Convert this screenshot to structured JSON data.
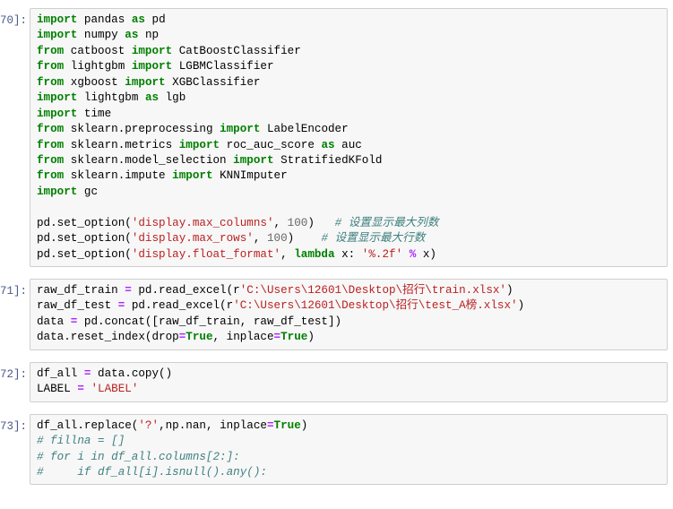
{
  "app": {
    "name": "jupyter-notebook",
    "background": "#ffffff"
  },
  "theme": {
    "cell_background": "#f7f7f7",
    "cell_border": "#cfcfcf",
    "prompt_color": "#4a5a8a",
    "keyword_color": "#008000",
    "string_color": "#BA2121",
    "comment_color": "#408080",
    "operator_color": "#AA22FF",
    "number_color": "#666666",
    "text_color": "#000000"
  },
  "cells": [
    {
      "prompt": "70]:",
      "lines": [
        [
          {
            "t": "import",
            "c": "k"
          },
          {
            "t": " pandas ",
            "c": "nn"
          },
          {
            "t": "as",
            "c": "k"
          },
          {
            "t": " pd",
            "c": "nn"
          }
        ],
        [
          {
            "t": "import",
            "c": "k"
          },
          {
            "t": " numpy ",
            "c": "nn"
          },
          {
            "t": "as",
            "c": "k"
          },
          {
            "t": " np",
            "c": "nn"
          }
        ],
        [
          {
            "t": "from",
            "c": "k"
          },
          {
            "t": " catboost ",
            "c": "nn"
          },
          {
            "t": "import",
            "c": "k"
          },
          {
            "t": " CatBoostClassifier",
            "c": "nn"
          }
        ],
        [
          {
            "t": "from",
            "c": "k"
          },
          {
            "t": " lightgbm ",
            "c": "nn"
          },
          {
            "t": "import",
            "c": "k"
          },
          {
            "t": " LGBMClassifier",
            "c": "nn"
          }
        ],
        [
          {
            "t": "from",
            "c": "k"
          },
          {
            "t": " xgboost ",
            "c": "nn"
          },
          {
            "t": "import",
            "c": "k"
          },
          {
            "t": " XGBClassifier",
            "c": "nn"
          }
        ],
        [
          {
            "t": "import",
            "c": "k"
          },
          {
            "t": " lightgbm ",
            "c": "nn"
          },
          {
            "t": "as",
            "c": "k"
          },
          {
            "t": " lgb",
            "c": "nn"
          }
        ],
        [
          {
            "t": "import",
            "c": "k"
          },
          {
            "t": " time",
            "c": "nn"
          }
        ],
        [
          {
            "t": "from",
            "c": "k"
          },
          {
            "t": " sklearn.preprocessing ",
            "c": "nn"
          },
          {
            "t": "import",
            "c": "k"
          },
          {
            "t": " LabelEncoder",
            "c": "nn"
          }
        ],
        [
          {
            "t": "from",
            "c": "k"
          },
          {
            "t": " sklearn.metrics ",
            "c": "nn"
          },
          {
            "t": "import",
            "c": "k"
          },
          {
            "t": " roc_auc_score ",
            "c": "nn"
          },
          {
            "t": "as",
            "c": "k"
          },
          {
            "t": " auc",
            "c": "nn"
          }
        ],
        [
          {
            "t": "from",
            "c": "k"
          },
          {
            "t": " sklearn.model_selection ",
            "c": "nn"
          },
          {
            "t": "import",
            "c": "k"
          },
          {
            "t": " StratifiedKFold",
            "c": "nn"
          }
        ],
        [
          {
            "t": "from",
            "c": "k"
          },
          {
            "t": " sklearn.impute ",
            "c": "nn"
          },
          {
            "t": "import",
            "c": "k"
          },
          {
            "t": " KNNImputer",
            "c": "nn"
          }
        ],
        [
          {
            "t": "import",
            "c": "k"
          },
          {
            "t": " gc",
            "c": "nn"
          }
        ],
        [
          {
            "t": "",
            "c": "nn"
          }
        ],
        [
          {
            "t": "pd.set_option(",
            "c": "nn"
          },
          {
            "t": "'display.max_columns'",
            "c": "s"
          },
          {
            "t": ", ",
            "c": "nn"
          },
          {
            "t": "100",
            "c": "n"
          },
          {
            "t": ")   ",
            "c": "nn"
          },
          {
            "t": "# 设置显示最大列数",
            "c": "c"
          }
        ],
        [
          {
            "t": "pd.set_option(",
            "c": "nn"
          },
          {
            "t": "'display.max_rows'",
            "c": "s"
          },
          {
            "t": ", ",
            "c": "nn"
          },
          {
            "t": "100",
            "c": "n"
          },
          {
            "t": ")    ",
            "c": "nn"
          },
          {
            "t": "# 设置显示最大行数",
            "c": "c"
          }
        ],
        [
          {
            "t": "pd.set_option(",
            "c": "nn"
          },
          {
            "t": "'display.float_format'",
            "c": "s"
          },
          {
            "t": ", ",
            "c": "nn"
          },
          {
            "t": "lambda",
            "c": "k"
          },
          {
            "t": " x: ",
            "c": "nn"
          },
          {
            "t": "'%.2f'",
            "c": "s"
          },
          {
            "t": " ",
            "c": "nn"
          },
          {
            "t": "%",
            "c": "o"
          },
          {
            "t": " x)",
            "c": "nn"
          }
        ]
      ]
    },
    {
      "prompt": "71]:",
      "lines": [
        [
          {
            "t": "raw_df_train ",
            "c": "nn"
          },
          {
            "t": "=",
            "c": "o"
          },
          {
            "t": " pd.read_excel(r",
            "c": "nn"
          },
          {
            "t": "'C:\\Users\\12601\\Desktop\\招行\\train.xlsx'",
            "c": "s"
          },
          {
            "t": ")",
            "c": "nn"
          }
        ],
        [
          {
            "t": "raw_df_test ",
            "c": "nn"
          },
          {
            "t": "=",
            "c": "o"
          },
          {
            "t": " pd.read_excel(r",
            "c": "nn"
          },
          {
            "t": "'C:\\Users\\12601\\Desktop\\招行\\test_A榜.xlsx'",
            "c": "s"
          },
          {
            "t": ")",
            "c": "nn"
          }
        ],
        [
          {
            "t": "data ",
            "c": "nn"
          },
          {
            "t": "=",
            "c": "o"
          },
          {
            "t": " pd.concat([raw_df_train, raw_df_test])",
            "c": "nn"
          }
        ],
        [
          {
            "t": "data.reset_index(drop",
            "c": "nn"
          },
          {
            "t": "=",
            "c": "o"
          },
          {
            "t": "True",
            "c": "k"
          },
          {
            "t": ", inplace",
            "c": "nn"
          },
          {
            "t": "=",
            "c": "o"
          },
          {
            "t": "True",
            "c": "k"
          },
          {
            "t": ")",
            "c": "nn"
          }
        ]
      ]
    },
    {
      "prompt": "72]:",
      "lines": [
        [
          {
            "t": "df_all ",
            "c": "nn"
          },
          {
            "t": "=",
            "c": "o"
          },
          {
            "t": " data.copy()",
            "c": "nn"
          }
        ],
        [
          {
            "t": "LABEL ",
            "c": "nn"
          },
          {
            "t": "=",
            "c": "o"
          },
          {
            "t": " ",
            "c": "nn"
          },
          {
            "t": "'LABEL'",
            "c": "s"
          }
        ]
      ]
    },
    {
      "prompt": "73]:",
      "lines": [
        [
          {
            "t": "df_all.replace(",
            "c": "nn"
          },
          {
            "t": "'?'",
            "c": "s"
          },
          {
            "t": ",np.nan, inplace",
            "c": "nn"
          },
          {
            "t": "=",
            "c": "o"
          },
          {
            "t": "True",
            "c": "k"
          },
          {
            "t": ")",
            "c": "nn"
          }
        ],
        [
          {
            "t": "# fillna = []",
            "c": "c"
          }
        ],
        [
          {
            "t": "# for i in df_all.columns[2:]:",
            "c": "c"
          }
        ],
        [
          {
            "t": "#     if df_all[i].isnull().any():",
            "c": "c"
          }
        ]
      ]
    }
  ]
}
